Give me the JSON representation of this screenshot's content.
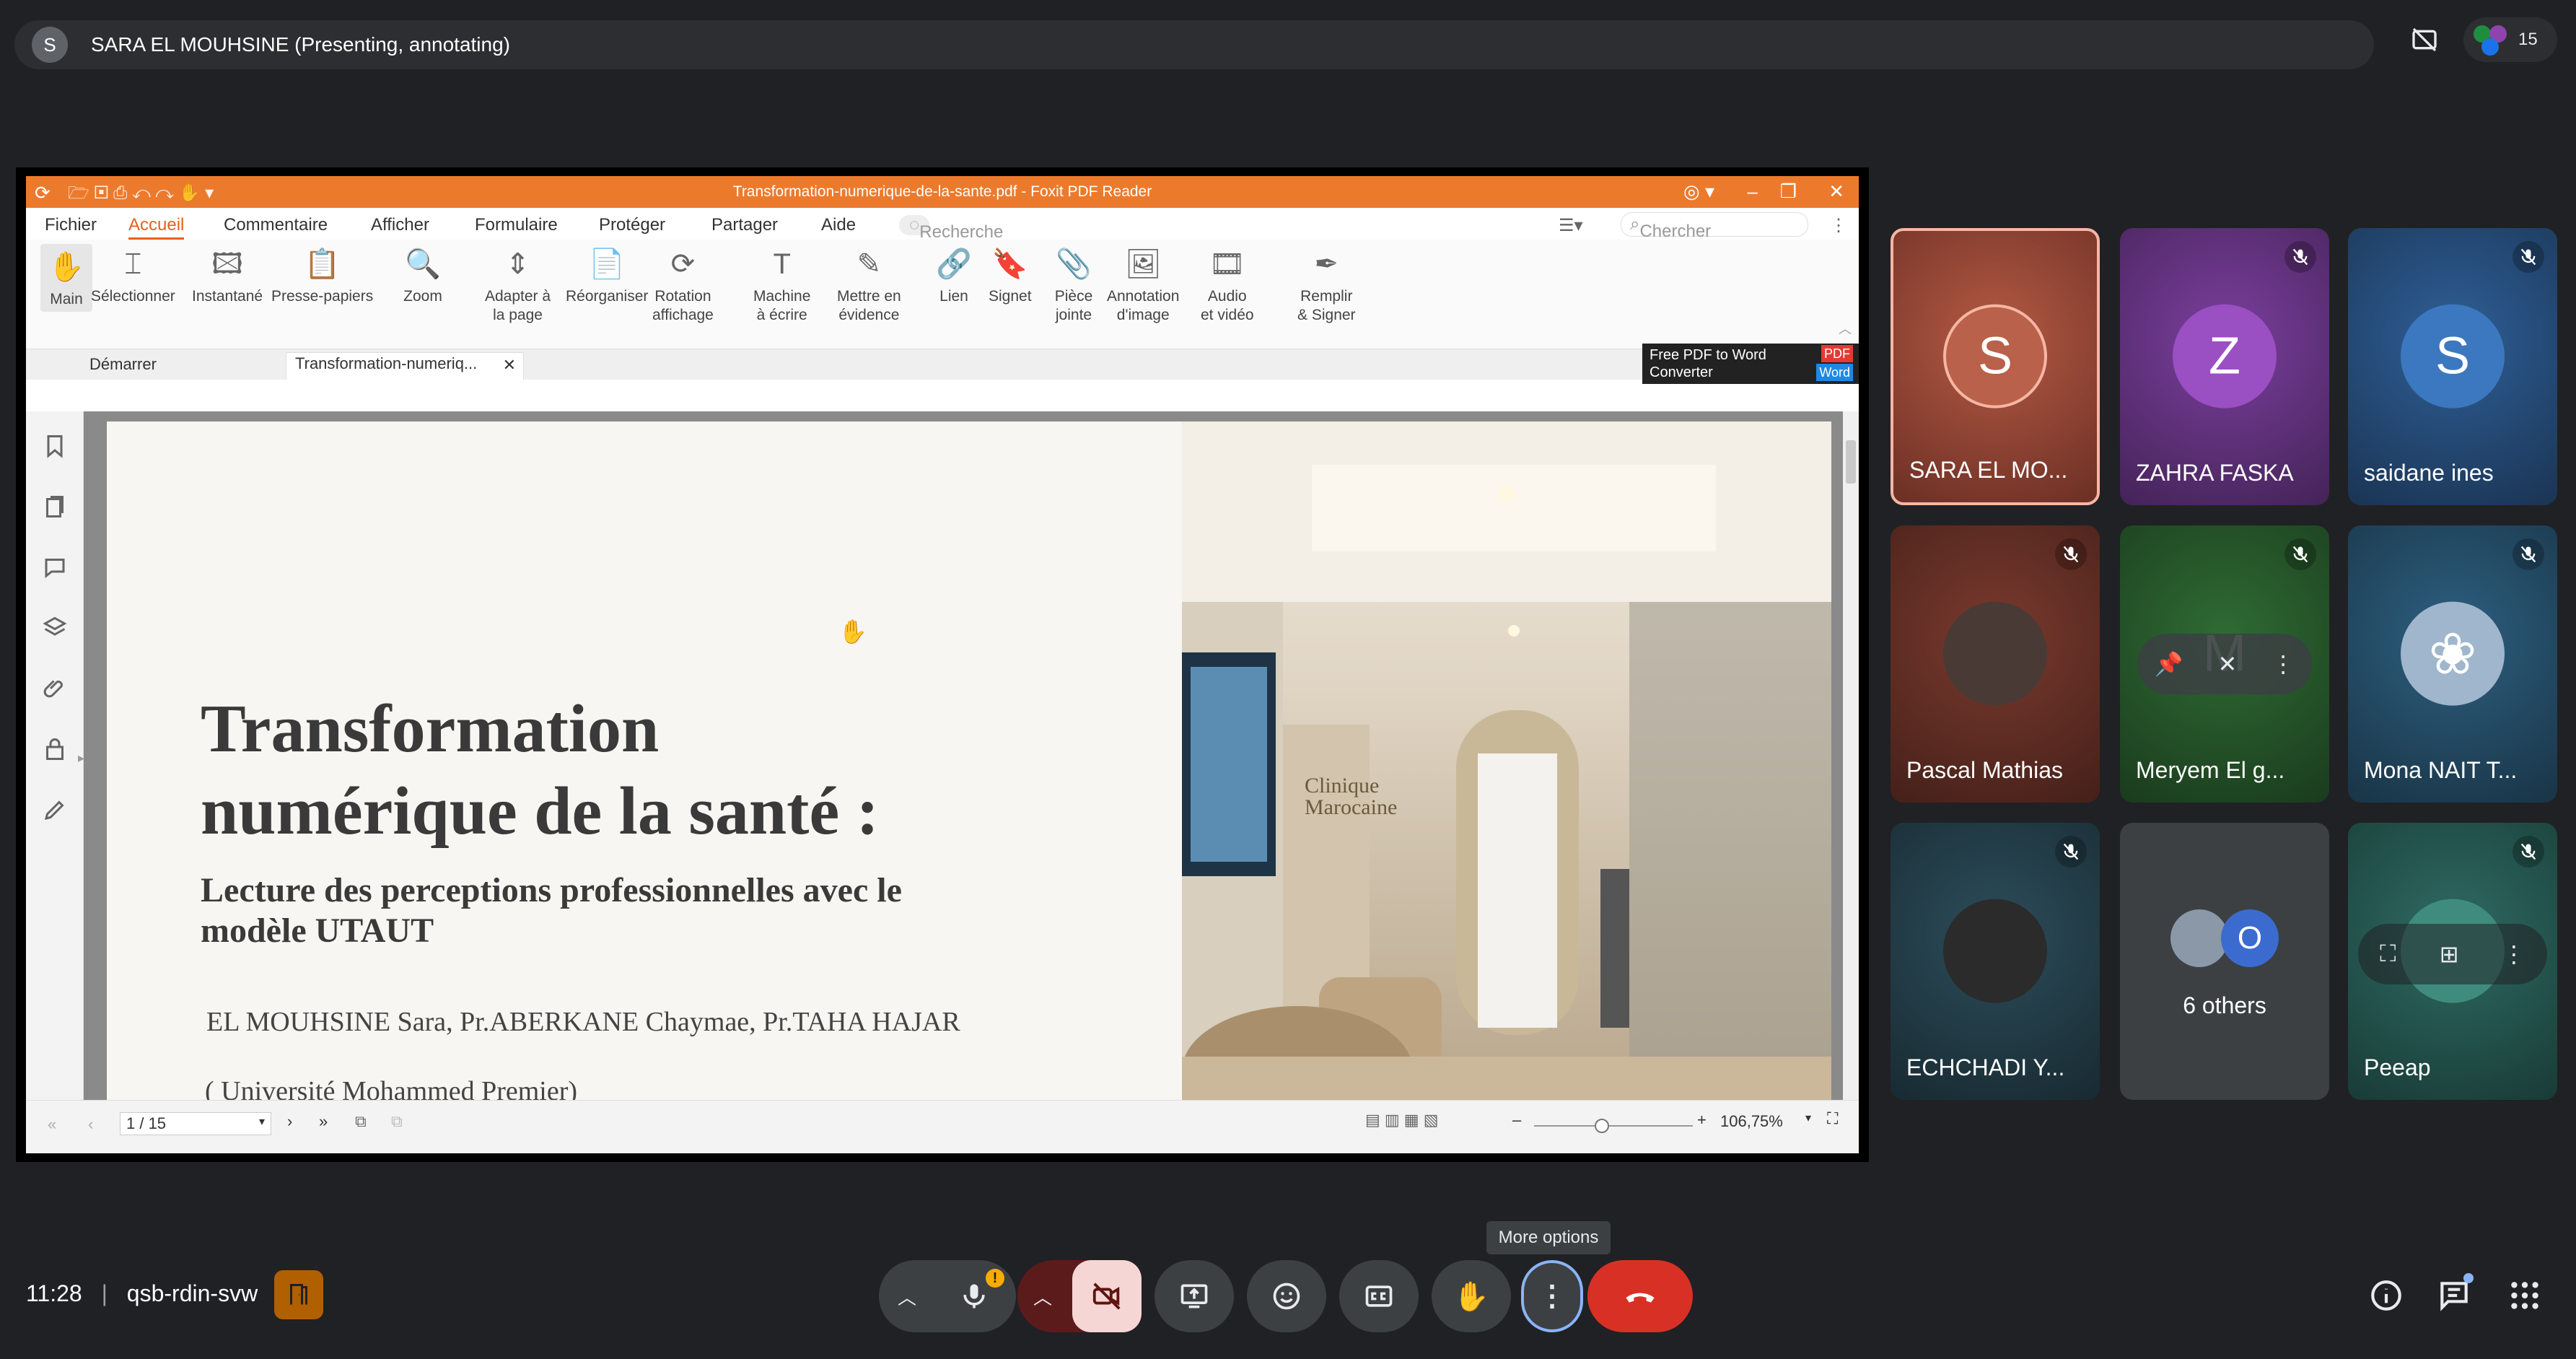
{
  "topbar": {
    "avatar_letter": "S",
    "presenter_text": "SARA EL MOUHSINE (Presenting, annotating)",
    "people_count": "15"
  },
  "app": {
    "title": "Transformation-numerique-de-la-sante.pdf - Foxit PDF Reader",
    "menu": [
      "Fichier",
      "Accueil",
      "Commentaire",
      "Afficher",
      "Formulaire",
      "Protéger",
      "Partager",
      "Aide"
    ],
    "menu_search_placeholder": "Recherche",
    "search_placeholder": "Chercher",
    "ribbon": [
      {
        "label": "Main"
      },
      {
        "label": "Sélectionner"
      },
      {
        "label": "Instantané"
      },
      {
        "label": "Presse-papiers"
      },
      {
        "label": "Zoom"
      },
      {
        "label": "Adapter à\nla page"
      },
      {
        "label": "Réorganiser"
      },
      {
        "label": "Rotation\naffichage"
      },
      {
        "label": "Machine\nà écrire"
      },
      {
        "label": "Mettre en\névidence"
      },
      {
        "label": "Lien"
      },
      {
        "label": "Signet"
      },
      {
        "label": "Pièce\njointe"
      },
      {
        "label": "Annotation\nd'image"
      },
      {
        "label": "Audio\net vidéo"
      },
      {
        "label": "Remplir\n& Signer"
      }
    ],
    "tabs": [
      "Démarrer",
      "Transformation-numeriq..."
    ],
    "ad": {
      "line1": "Free PDF to Word",
      "line2": "Converter",
      "badge1": "PDF",
      "badge2": "Word"
    },
    "slide": {
      "title1": "Transformation",
      "title2": "numérique de la santé :",
      "subtitle1": "Lecture des perceptions professionnelles avec le",
      "subtitle2": "modèle UTAUT",
      "authors": "EL MOUHSINE Sara, Pr.ABERKANE Chaymae, Pr.TAHA HAJAR",
      "affiliation": "( Université Mohammed Premier)",
      "photo_sign": "Clinique Marocaine"
    },
    "status": {
      "page": "1 / 15",
      "zoom": "106,75%"
    }
  },
  "participants": [
    {
      "name": "SARA EL MO...",
      "letter": "S",
      "color": "#9c4f3e",
      "avatar": "#b9614a",
      "muted": false
    },
    {
      "name": "ZAHRA FASKA",
      "letter": "Z",
      "color": "#7b3f9e",
      "avatar": "#9a4fc2",
      "muted": true
    },
    {
      "name": "saidane ines",
      "letter": "S",
      "color": "#2f5f97",
      "avatar": "#3c78c0",
      "muted": true
    },
    {
      "name": "Pascal Mathias",
      "letter": "",
      "color": "#7b3a2e",
      "muted": true
    },
    {
      "name": "Meryem El g...",
      "letter": "M",
      "color": "#2f6b34",
      "muted": true
    },
    {
      "name": "Mona NAIT T...",
      "letter": "",
      "color": "#2d5f80",
      "muted": true
    },
    {
      "name": "ECHCHADI Y...",
      "letter": "",
      "color": "#2c4d5a",
      "muted": true
    },
    {
      "name": "6 others",
      "letter": "O",
      "color": "#3c4043",
      "muted": false
    },
    {
      "name": "Peeap",
      "letter": "",
      "color": "#2e6b63",
      "muted": true
    }
  ],
  "bottom": {
    "time": "11:28",
    "meeting_code": "qsb-rdin-svw",
    "tooltip": "More options"
  },
  "colors": {
    "foxit_orange": "#ec7a2c",
    "end_call": "#d93025",
    "camera_off": "#f6d6d4",
    "highlight_ring": "#8ab4f8"
  }
}
